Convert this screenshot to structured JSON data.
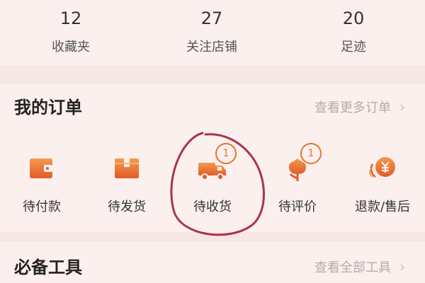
{
  "stats": [
    {
      "count": "12",
      "label": "收藏夹"
    },
    {
      "count": "27",
      "label": "关注店铺"
    },
    {
      "count": "20",
      "label": "足迹"
    }
  ],
  "orders_section": {
    "title": "我的订单",
    "more_label": "查看更多订单",
    "items": [
      {
        "label": "待付款",
        "icon": "wallet-icon"
      },
      {
        "label": "待发货",
        "icon": "package-icon"
      },
      {
        "label": "待收货",
        "icon": "delivery-truck-icon",
        "badge": "1"
      },
      {
        "label": "待评价",
        "icon": "flower-review-icon",
        "badge": "1"
      },
      {
        "label": "退款/售后",
        "icon": "refund-yen-icon"
      }
    ]
  },
  "tools_section": {
    "title": "必备工具",
    "more_label": "查看全部工具"
  },
  "colors": {
    "accent": "#e3742d",
    "annotation": "#a8334f"
  }
}
